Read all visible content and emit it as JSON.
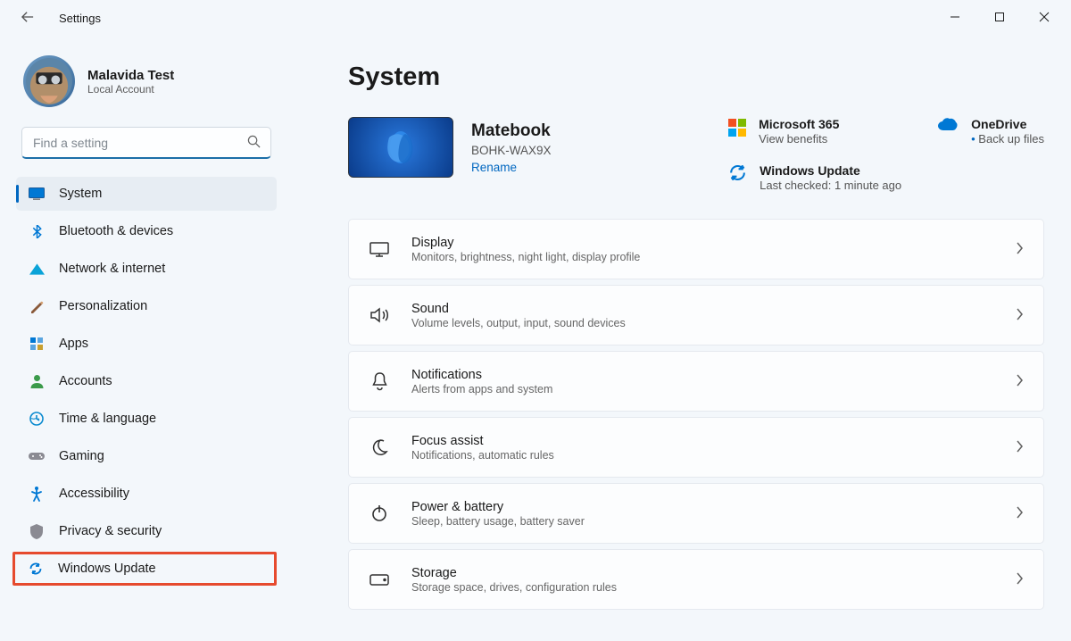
{
  "window": {
    "title": "Settings"
  },
  "user": {
    "name": "Malavida Test",
    "account_type": "Local Account"
  },
  "search": {
    "placeholder": "Find a setting"
  },
  "nav": {
    "items": [
      {
        "id": "system",
        "label": "System",
        "active": true
      },
      {
        "id": "bluetooth",
        "label": "Bluetooth & devices"
      },
      {
        "id": "network",
        "label": "Network & internet"
      },
      {
        "id": "personal",
        "label": "Personalization"
      },
      {
        "id": "apps",
        "label": "Apps"
      },
      {
        "id": "accounts",
        "label": "Accounts"
      },
      {
        "id": "time",
        "label": "Time & language"
      },
      {
        "id": "gaming",
        "label": "Gaming"
      },
      {
        "id": "access",
        "label": "Accessibility"
      },
      {
        "id": "privacy",
        "label": "Privacy & security"
      },
      {
        "id": "update",
        "label": "Windows Update",
        "highlight": true
      }
    ]
  },
  "page": {
    "title": "System"
  },
  "device": {
    "name": "Matebook",
    "model": "BOHK-WAX9X",
    "rename": "Rename"
  },
  "promos": {
    "m365": {
      "title": "Microsoft 365",
      "sub": "View benefits"
    },
    "onedrive": {
      "title": "OneDrive",
      "sub": "Back up files"
    },
    "update": {
      "title": "Windows Update",
      "sub": "Last checked: 1 minute ago"
    }
  },
  "settings": [
    {
      "id": "display",
      "title": "Display",
      "sub": "Monitors, brightness, night light, display profile"
    },
    {
      "id": "sound",
      "title": "Sound",
      "sub": "Volume levels, output, input, sound devices"
    },
    {
      "id": "notif",
      "title": "Notifications",
      "sub": "Alerts from apps and system"
    },
    {
      "id": "focus",
      "title": "Focus assist",
      "sub": "Notifications, automatic rules"
    },
    {
      "id": "power",
      "title": "Power & battery",
      "sub": "Sleep, battery usage, battery saver"
    },
    {
      "id": "storage",
      "title": "Storage",
      "sub": "Storage space, drives, configuration rules"
    }
  ]
}
